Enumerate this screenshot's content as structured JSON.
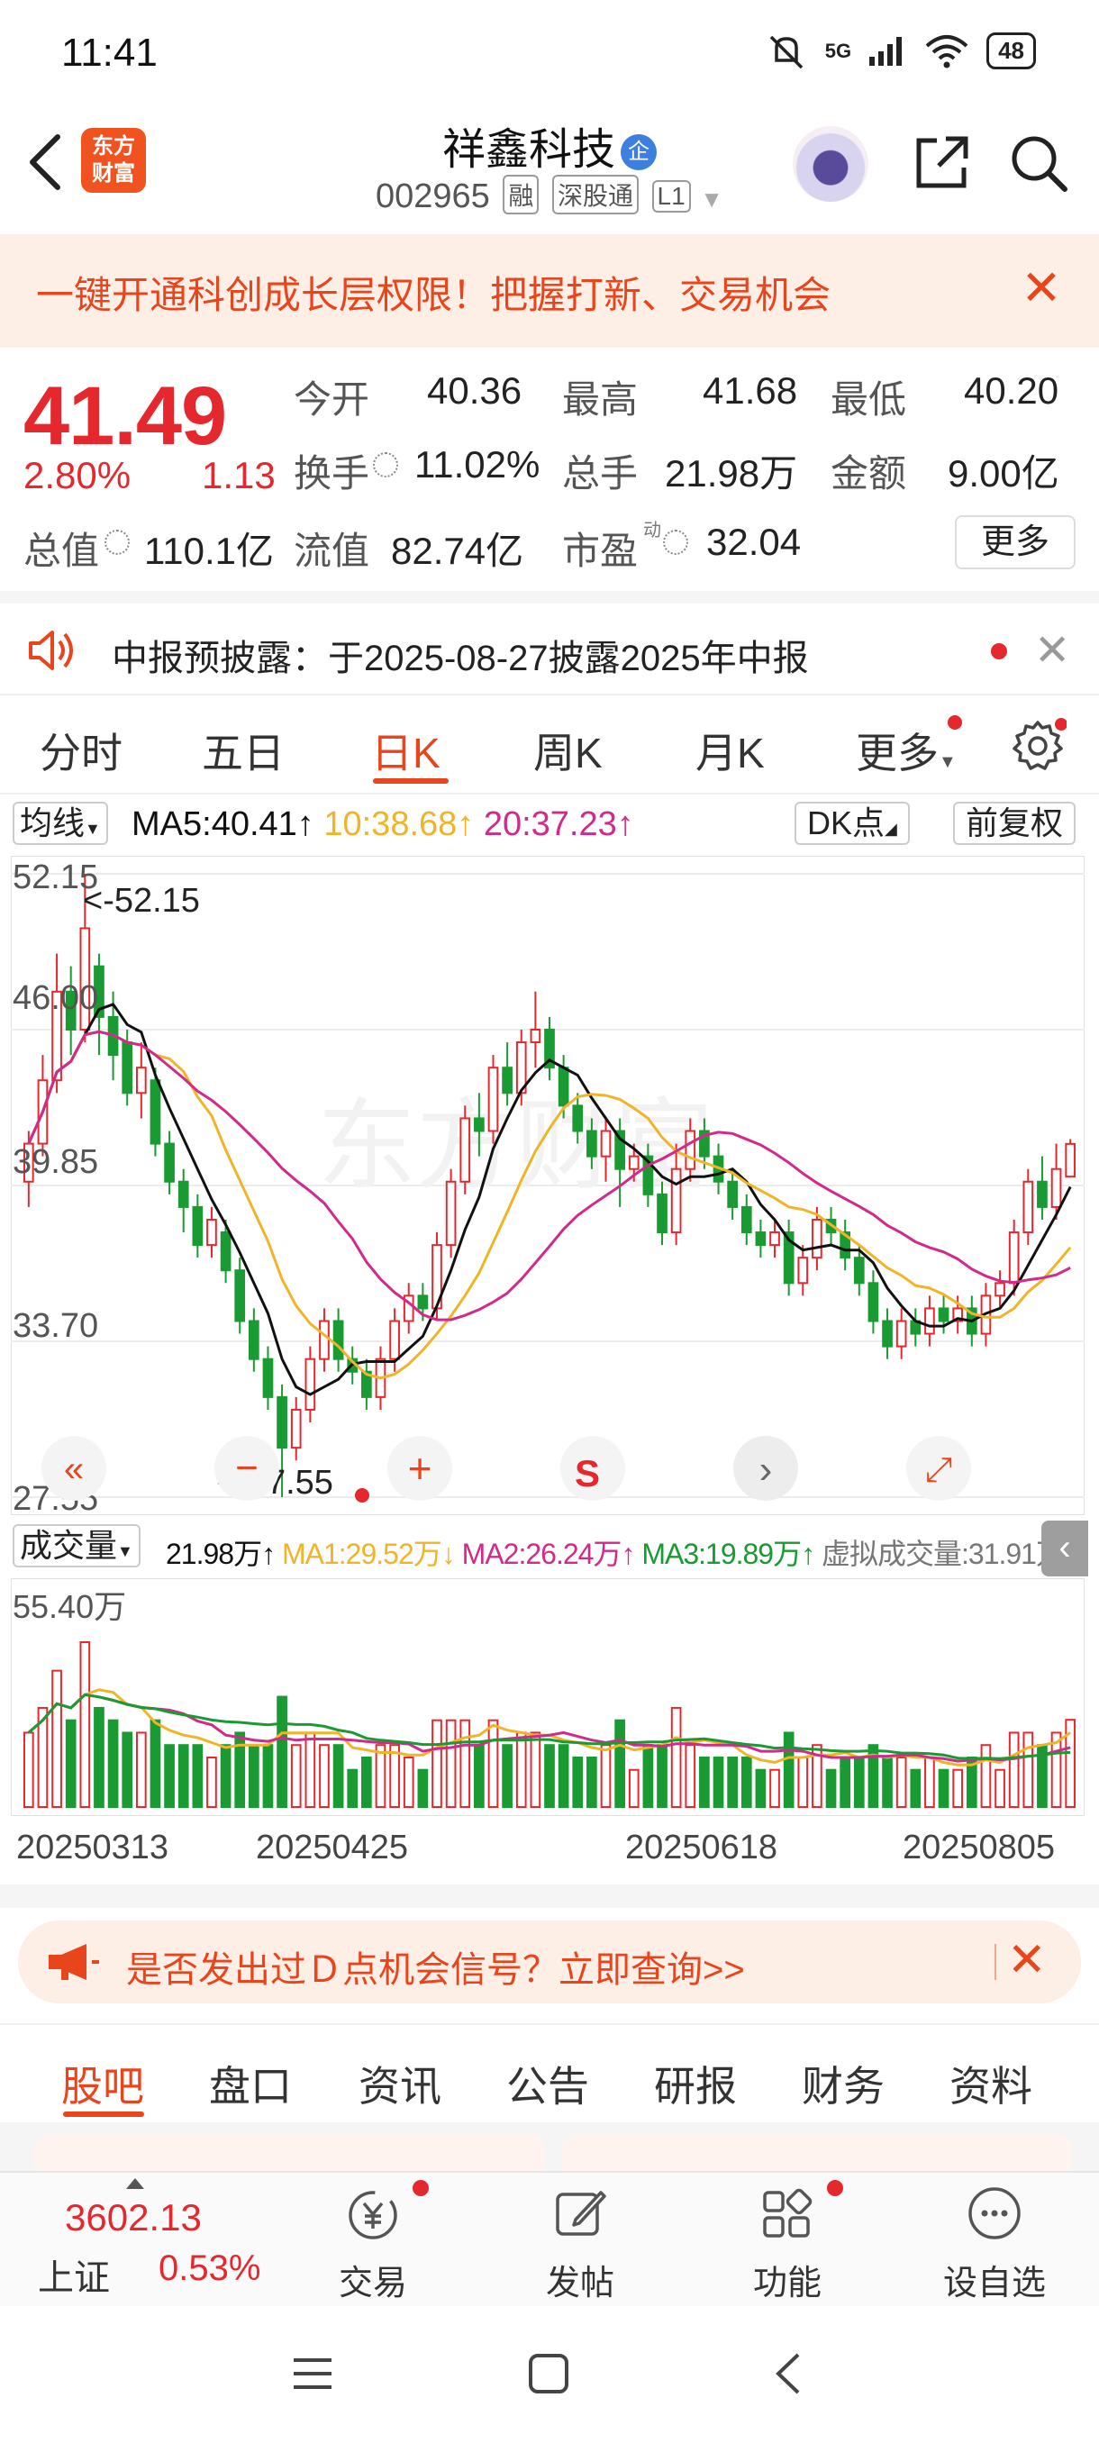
{
  "status_bar": {
    "time": "11:41",
    "network": "5G",
    "battery": "48",
    "icons": [
      "mute-icon",
      "signal-icon",
      "wifi-icon",
      "battery-icon"
    ]
  },
  "header": {
    "title": "祥鑫科技",
    "badge": "企",
    "code": "002965",
    "tags": [
      "融",
      "深股通",
      "L1"
    ],
    "logo_line1": "东方",
    "logo_line2": "财富"
  },
  "promo": {
    "text": "一键开通科创成长层权限！把握打新、交易机会",
    "close": "✕"
  },
  "quote": {
    "price": "41.49",
    "change_pct": "2.80%",
    "change": "1.13",
    "open_label": "今开",
    "open": "40.36",
    "high_label": "最高",
    "high": "41.68",
    "low_label": "最低",
    "low": "40.20",
    "turnover_label": "换手",
    "turnover": "11.02%",
    "volume_label": "总手",
    "volume": "21.98万",
    "amount_label": "金额",
    "amount": "9.00亿",
    "mktcap_label": "总值",
    "mktcap": "110.1亿",
    "float_label": "流值",
    "float": "82.74亿",
    "pe_label": "市盈",
    "pe_sup": "动",
    "pe": "32.04",
    "more": "更多"
  },
  "notice": {
    "text": "中报预披露：于2025-08-27披露2025年中报"
  },
  "period_tabs": [
    "分时",
    "五日",
    "日K",
    "周K",
    "月K",
    "更多"
  ],
  "ma_bar": {
    "selector": "均线",
    "ma5": "MA5:40.41↑",
    "ma10": "10:38.68↑",
    "ma20": "20:37.23↑",
    "dk": "DK点",
    "adjust": "前复权"
  },
  "kline": {
    "y_labels": [
      "52.15",
      "46.00",
      "39.85",
      "33.70",
      "27.55"
    ],
    "max_label": "<-52.15",
    "min_label": "<-27.55",
    "watermark": "东方财富",
    "controls": [
      "«",
      "−",
      "+",
      "S",
      "›",
      "⤢"
    ]
  },
  "volume_header": {
    "selector": "成交量",
    "vol": "21.98万↑",
    "ma1": "MA1:29.52万↓",
    "ma2": "MA2:26.24万↑",
    "ma3": "MA3:19.89万↑",
    "virtual": "虚拟成交量:31.91万",
    "max_label": "55.40万"
  },
  "dates": [
    "20250313",
    "20250425",
    "20250618",
    "20250805"
  ],
  "dpoint_banner": {
    "text": "是否发出过Ｄ点机会信号？立即查询>>"
  },
  "content_tabs": [
    "股吧",
    "盘口",
    "资讯",
    "公告",
    "研报",
    "财务",
    "资料"
  ],
  "bottom_nav": {
    "index_value": "3602.13",
    "index_name": "上证",
    "index_pct": "0.53%",
    "items": [
      "交易",
      "发帖",
      "功能",
      "设自选"
    ]
  },
  "colors": {
    "up": "#e5282e",
    "down": "#1a9a32",
    "accent": "#e8451c",
    "ma5": "#111111",
    "ma10": "#f0b429",
    "ma20": "#d22a8a"
  },
  "chart_data": {
    "type": "candlestick",
    "ylim": [
      27.55,
      52.15
    ],
    "y_ticks": [
      52.15,
      46.0,
      39.85,
      33.7,
      27.55
    ],
    "x_ticks": [
      "20250313",
      "20250425",
      "20250618",
      "20250805"
    ],
    "candles": [
      [
        40.0,
        41.5,
        39.0,
        42.0
      ],
      [
        41.5,
        44.0,
        41.0,
        45.0
      ],
      [
        44.0,
        47.5,
        43.5,
        49.0
      ],
      [
        47.5,
        46.0,
        45.0,
        48.5
      ],
      [
        46.0,
        50.0,
        45.5,
        52.15
      ],
      [
        48.5,
        46.5,
        45.0,
        49.0
      ],
      [
        46.5,
        45.0,
        44.0,
        47.5
      ],
      [
        45.5,
        43.5,
        43.0,
        46.0
      ],
      [
        43.5,
        44.5,
        42.5,
        45.5
      ],
      [
        44.0,
        41.5,
        41.0,
        44.5
      ],
      [
        41.5,
        40.0,
        39.5,
        42.0
      ],
      [
        40.0,
        39.0,
        38.0,
        40.5
      ],
      [
        39.0,
        37.5,
        37.0,
        39.5
      ],
      [
        37.5,
        38.5,
        37.0,
        39.0
      ],
      [
        38.0,
        36.5,
        36.0,
        38.5
      ],
      [
        36.5,
        34.5,
        34.0,
        37.0
      ],
      [
        34.5,
        33.0,
        32.5,
        35.0
      ],
      [
        33.0,
        31.5,
        31.0,
        33.5
      ],
      [
        31.5,
        29.5,
        27.55,
        32.0
      ],
      [
        29.5,
        31.0,
        29.0,
        31.5
      ],
      [
        31.0,
        33.0,
        30.5,
        33.5
      ],
      [
        33.0,
        34.5,
        32.5,
        35.0
      ],
      [
        34.5,
        33.0,
        32.5,
        35.0
      ],
      [
        33.0,
        32.5,
        32.0,
        33.5
      ],
      [
        32.5,
        31.5,
        31.0,
        33.0
      ],
      [
        31.5,
        33.0,
        31.0,
        33.5
      ],
      [
        33.0,
        34.5,
        32.5,
        35.0
      ],
      [
        34.5,
        35.5,
        34.0,
        36.0
      ],
      [
        35.5,
        35.0,
        34.5,
        36.0
      ],
      [
        35.0,
        37.5,
        34.5,
        38.0
      ],
      [
        37.5,
        40.0,
        37.0,
        40.5
      ],
      [
        40.0,
        42.5,
        39.5,
        43.0
      ],
      [
        42.5,
        42.0,
        41.0,
        43.5
      ],
      [
        42.0,
        44.5,
        41.5,
        45.0
      ],
      [
        44.5,
        43.5,
        43.0,
        45.5
      ],
      [
        43.5,
        45.5,
        43.0,
        46.0
      ],
      [
        45.5,
        46.0,
        44.5,
        47.5
      ],
      [
        46.0,
        44.5,
        44.0,
        46.5
      ],
      [
        44.5,
        43.0,
        42.5,
        45.0
      ],
      [
        43.0,
        42.0,
        41.5,
        43.5
      ],
      [
        42.0,
        41.0,
        40.5,
        42.5
      ],
      [
        41.0,
        42.0,
        40.0,
        42.5
      ],
      [
        42.0,
        40.5,
        39.0,
        42.5
      ],
      [
        40.5,
        41.0,
        40.0,
        41.5
      ],
      [
        41.0,
        39.5,
        39.0,
        41.5
      ],
      [
        39.5,
        38.0,
        37.5,
        40.0
      ],
      [
        38.0,
        40.5,
        37.5,
        41.5
      ],
      [
        40.5,
        42.0,
        40.0,
        42.5
      ],
      [
        42.0,
        41.0,
        40.5,
        42.5
      ],
      [
        41.0,
        40.0,
        39.5,
        41.5
      ],
      [
        40.0,
        39.0,
        38.5,
        40.5
      ],
      [
        39.0,
        38.0,
        37.5,
        39.5
      ],
      [
        38.0,
        37.5,
        37.0,
        38.5
      ],
      [
        37.5,
        38.0,
        37.0,
        38.5
      ],
      [
        38.0,
        36.0,
        35.5,
        38.5
      ],
      [
        36.0,
        37.0,
        35.5,
        37.5
      ],
      [
        37.0,
        38.5,
        36.5,
        39.0
      ],
      [
        38.5,
        38.0,
        37.5,
        39.0
      ],
      [
        38.0,
        37.0,
        36.5,
        38.5
      ],
      [
        37.0,
        36.0,
        35.5,
        37.5
      ],
      [
        36.0,
        34.5,
        34.0,
        36.5
      ],
      [
        34.5,
        33.5,
        33.0,
        35.0
      ],
      [
        33.5,
        34.5,
        33.0,
        35.0
      ],
      [
        34.5,
        34.0,
        33.5,
        35.0
      ],
      [
        34.0,
        35.0,
        33.5,
        35.5
      ],
      [
        35.0,
        34.5,
        34.0,
        35.5
      ],
      [
        34.5,
        35.0,
        34.0,
        35.5
      ],
      [
        35.0,
        34.0,
        33.5,
        35.5
      ],
      [
        34.0,
        35.5,
        33.5,
        36.0
      ],
      [
        35.5,
        36.0,
        35.0,
        36.5
      ],
      [
        36.0,
        38.0,
        35.5,
        38.5
      ],
      [
        38.0,
        40.0,
        37.5,
        40.5
      ],
      [
        40.0,
        39.0,
        38.5,
        41.0
      ],
      [
        39.0,
        40.5,
        38.5,
        41.5
      ],
      [
        40.2,
        41.49,
        40.2,
        41.68
      ]
    ],
    "series": [
      {
        "name": "MA5",
        "last": 40.41
      },
      {
        "name": "MA10",
        "last": 38.68
      },
      {
        "name": "MA20",
        "last": 37.23
      }
    ],
    "volume_max": 55.4,
    "volume_unit": "万",
    "volume_last": 21.98
  }
}
